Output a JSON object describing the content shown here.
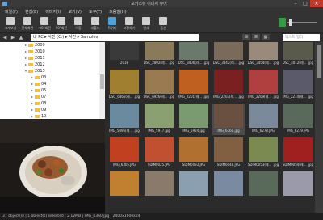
{
  "window": {
    "title": "포커스뷰 이미지 뷰어",
    "min": "–",
    "max": "□",
    "close": "✕"
  },
  "menu": [
    "파일(F)",
    "편집(E)",
    "이미지(I)",
    "보기(V)",
    "도구(T)",
    "도움말(H)"
  ],
  "toolbar": [
    {
      "label": "크게보기",
      "icon": "view-large-icon",
      "color": "#cfcfcf"
    },
    {
      "label": "전체화면",
      "icon": "fullscreen-icon",
      "color": "#cfcfcf"
    },
    {
      "label": "-90°회전",
      "icon": "rotate-left-icon",
      "color": "#cfcfcf"
    },
    {
      "label": "90°회전",
      "icon": "rotate-right-icon",
      "color": "#cfcfcf"
    },
    {
      "label": "이동",
      "icon": "move-icon",
      "color": "#cfcfcf"
    },
    {
      "label": "새폴더",
      "icon": "new-folder-icon",
      "color": "#cfcfcf"
    },
    {
      "label": "트위터",
      "icon": "twitter-icon",
      "color": "#4aa3df"
    },
    {
      "label": "보정하기",
      "icon": "adjust-icon",
      "color": "#cfcfcf"
    },
    {
      "label": "인쇄",
      "icon": "print-icon",
      "color": "#cfcfcf"
    },
    {
      "label": "옵션",
      "icon": "options-icon",
      "color": "#cfcfcf"
    }
  ],
  "address": {
    "back": "◀",
    "forward": "▶",
    "up": "▲",
    "path": "내 PC ▸ 사진 (C:) ▸ 사진 ▸ Samples"
  },
  "view_buttons": [
    "⊞",
    "☰",
    "▦"
  ],
  "search": {
    "placeholder": "텍스트 필터"
  },
  "tree": [
    {
      "label": "2009",
      "expanded": false
    },
    {
      "label": "2010",
      "expanded": false
    },
    {
      "label": "2011",
      "expanded": false
    },
    {
      "label": "2012",
      "expanded": false
    },
    {
      "label": "2013",
      "expanded": true
    },
    {
      "label": "03",
      "expanded": false
    },
    {
      "label": "04",
      "expanded": false
    },
    {
      "label": "05",
      "expanded": false
    },
    {
      "label": "07",
      "expanded": false
    },
    {
      "label": "08",
      "expanded": false
    },
    {
      "label": "09",
      "expanded": false
    },
    {
      "label": "10",
      "expanded": false
    }
  ],
  "thumbnails": [
    {
      "caption": "2018",
      "color": "#3a3a3a"
    },
    {
      "caption": "DSC_2802(레... .jpg",
      "color": "#8a7a5a"
    },
    {
      "caption": "DSC_3406(레... .jpg",
      "color": "#6a7a6a"
    },
    {
      "caption": "DSC_3442(레... .jpg",
      "color": "#7a6a5a"
    },
    {
      "caption": "DSC_3454(레... .jpg",
      "color": "#9a8a7a"
    },
    {
      "caption": "DSC_4012(레... .jpg",
      "color": "#5a5a4a"
    },
    {
      "caption": "DSC_6865(레... .jpg",
      "color": "#a08030"
    },
    {
      "caption": "DSC_6926(레... .jpg",
      "color": "#9a7a50"
    },
    {
      "caption": "IMG_2201(레... .jpg",
      "color": "#c06020"
    },
    {
      "caption": "IMG_2203(레... .jpg",
      "color": "#7a2020"
    },
    {
      "caption": "IMG_2209(레... .jpg",
      "color": "#b04040"
    },
    {
      "caption": "IMG_2214(레... .jpg",
      "color": "#5a5a6a"
    },
    {
      "caption": "IMG_5896(레... .jpg",
      "color": "#6a8aa0"
    },
    {
      "caption": "IMG_5917.jpg",
      "color": "#8aa070"
    },
    {
      "caption": "IMG_5924.jpg",
      "color": "#7a9a70"
    },
    {
      "caption": "IMG_6360.jpg",
      "color": "#6a5040"
    },
    {
      "caption": "IMG_6278.JPG",
      "color": "#7a8a9a"
    },
    {
      "caption": "IMG_6279.JPG",
      "color": "#5a6a5a"
    },
    {
      "caption": "IMG_6305.JPG",
      "color": "#c04020"
    },
    {
      "caption": "SDIM0025.JPG",
      "color": "#c05030"
    },
    {
      "caption": "SDIM0033.JPG",
      "color": "#b07030"
    },
    {
      "caption": "SDIM0048.JPG",
      "color": "#806040"
    },
    {
      "caption": "SDIM0053(레... .jpg",
      "color": "#7a8a50"
    },
    {
      "caption": "SDIM0054(레... .jpg",
      "color": "#a02020"
    },
    {
      "caption": "",
      "color": "#c08030"
    },
    {
      "caption": "",
      "color": "#8a7a6a"
    },
    {
      "caption": "",
      "color": "#8aa0b0"
    },
    {
      "caption": "",
      "color": "#7a8aa0"
    },
    {
      "caption": "",
      "color": "#5a6a5a"
    },
    {
      "caption": "",
      "color": "#9a9aaa"
    }
  ],
  "status": "37 object(s) | 1 object(s) selected | 2.12MB | IMG_6360.jpg | 2400x1600x24"
}
